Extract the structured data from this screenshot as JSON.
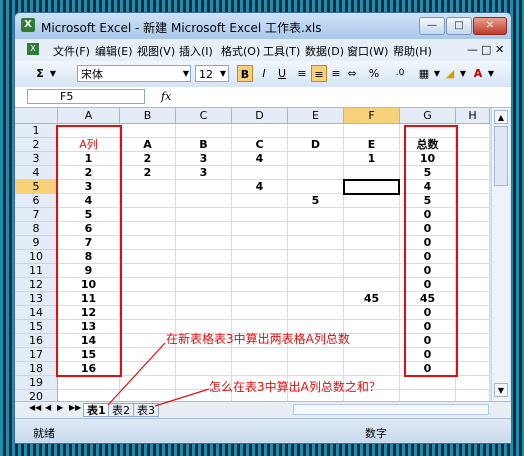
{
  "window": {
    "title": "Microsoft Excel - 新建 Microsoft Excel 工作表.xls",
    "app_icon": "X"
  },
  "menu": [
    "文件(F)",
    "编辑(E)",
    "视图(V)",
    "插入(I)",
    "格式(O)",
    "工具(T)",
    "数据(D)",
    "窗口(W)",
    "帮助(H)"
  ],
  "toolbar": {
    "sum": "Σ",
    "font": "宋体",
    "size": "12",
    "bold": "B",
    "italic": "I",
    "underline": "U",
    "currency": "%",
    "decimals": ".0"
  },
  "formula_bar": {
    "name_box": "F5",
    "fx": "fx",
    "value": ""
  },
  "columns": [
    "A",
    "B",
    "C",
    "D",
    "E",
    "F",
    "G",
    "H"
  ],
  "rows": [
    "1",
    "2",
    "3",
    "4",
    "5",
    "6",
    "7",
    "8",
    "9",
    "10",
    "11",
    "12",
    "13",
    "14",
    "15",
    "16",
    "17",
    "18",
    "19",
    "20"
  ],
  "cells": [
    [
      "",
      "",
      "",
      "",
      "",
      "",
      "",
      ""
    ],
    [
      "A列",
      "A",
      "B",
      "C",
      "D",
      "E",
      "总数",
      ""
    ],
    [
      "1",
      "2",
      "3",
      "4",
      "",
      "1",
      "10",
      ""
    ],
    [
      "2",
      "2",
      "3",
      "",
      "",
      "",
      "5",
      ""
    ],
    [
      "3",
      "",
      "",
      "4",
      "",
      "",
      "4",
      ""
    ],
    [
      "4",
      "",
      "",
      "",
      "5",
      "",
      "5",
      ""
    ],
    [
      "5",
      "",
      "",
      "",
      "",
      "",
      "0",
      ""
    ],
    [
      "6",
      "",
      "",
      "",
      "",
      "",
      "0",
      ""
    ],
    [
      "7",
      "",
      "",
      "",
      "",
      "",
      "0",
      ""
    ],
    [
      "8",
      "",
      "",
      "",
      "",
      "",
      "0",
      ""
    ],
    [
      "9",
      "",
      "",
      "",
      "",
      "",
      "0",
      ""
    ],
    [
      "10",
      "",
      "",
      "",
      "",
      "",
      "0",
      ""
    ],
    [
      "11",
      "",
      "",
      "",
      "",
      "45",
      "45",
      ""
    ],
    [
      "12",
      "",
      "",
      "",
      "",
      "",
      "0",
      ""
    ],
    [
      "13",
      "",
      "",
      "",
      "",
      "",
      "0",
      ""
    ],
    [
      "14",
      "",
      "",
      "",
      "",
      "",
      "0",
      ""
    ],
    [
      "15",
      "",
      "",
      "",
      "",
      "",
      "0",
      ""
    ],
    [
      "16",
      "",
      "",
      "",
      "",
      "",
      "0",
      ""
    ],
    [
      "",
      "",
      "",
      "",
      "",
      "",
      "",
      ""
    ],
    [
      "",
      "",
      "",
      "",
      "",
      "",
      "",
      ""
    ]
  ],
  "sheets": [
    "表1",
    "表2",
    "表3"
  ],
  "status": {
    "left": "就绪",
    "right": "数字"
  },
  "annotations": {
    "note1": "在新表格表3中算出两表格A列总数",
    "note2": "怎么在表3中算出A列总数之和？"
  },
  "colors": {
    "accent": "#e01010",
    "selected_header": "#f7d07a"
  }
}
